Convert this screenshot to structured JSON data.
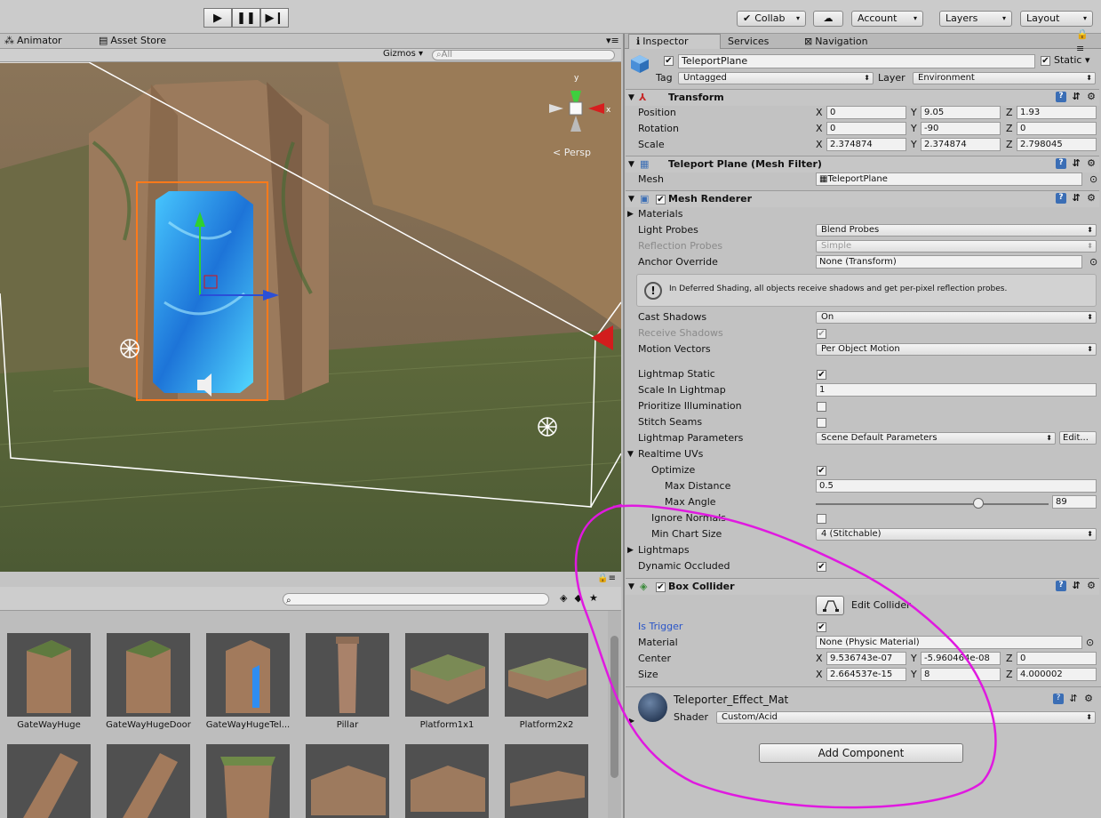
{
  "toolbar": {
    "collab": "Collab",
    "account": "Account",
    "layers": "Layers",
    "layout": "Layout"
  },
  "scene_tabs": {
    "animator": "Animator",
    "asset_store": "Asset Store"
  },
  "scene": {
    "gizmos": "Gizmos",
    "search_placeholder": "All",
    "persp": "Persp",
    "axis_y": "y",
    "axis_x": "x"
  },
  "assets": [
    {
      "name": "GateWayHuge"
    },
    {
      "name": "GateWayHugeDoor"
    },
    {
      "name": "GateWayHugeTel..."
    },
    {
      "name": "Pillar"
    },
    {
      "name": "Platform1x1"
    },
    {
      "name": "Platform2x2"
    }
  ],
  "inspector": {
    "tabs": [
      "Inspector",
      "Services",
      "Navigation"
    ],
    "object_name": "TeleportPlane",
    "static_label": "Static",
    "tag_label": "Tag",
    "tag_value": "Untagged",
    "layer_label": "Layer",
    "layer_value": "Environment",
    "transform": {
      "title": "Transform",
      "position": {
        "label": "Position",
        "x": "0",
        "y": "9.05",
        "z": "1.93"
      },
      "rotation": {
        "label": "Rotation",
        "x": "0",
        "y": "-90",
        "z": "0"
      },
      "scale": {
        "label": "Scale",
        "x": "2.374874",
        "y": "2.374874",
        "z": "2.798045"
      }
    },
    "mesh_filter": {
      "title": "Teleport Plane (Mesh Filter)",
      "mesh_label": "Mesh",
      "mesh_value": "TeleportPlane"
    },
    "mesh_renderer": {
      "title": "Mesh Renderer",
      "materials": "Materials",
      "light_probes_label": "Light Probes",
      "light_probes": "Blend Probes",
      "reflection_probes_label": "Reflection Probes",
      "reflection_probes": "Simple",
      "anchor_override_label": "Anchor Override",
      "anchor_override": "None (Transform)",
      "info": "In Deferred Shading, all objects receive shadows and get per-pixel reflection probes.",
      "cast_shadows_label": "Cast Shadows",
      "cast_shadows": "On",
      "receive_shadows_label": "Receive Shadows",
      "motion_vectors_label": "Motion Vectors",
      "motion_vectors": "Per Object Motion",
      "lightmap_static_label": "Lightmap Static",
      "scale_in_lightmap_label": "Scale In Lightmap",
      "scale_in_lightmap": "1",
      "prioritize_label": "Prioritize Illumination",
      "stitch_label": "Stitch Seams",
      "lightmap_params_label": "Lightmap Parameters",
      "lightmap_params": "Scene Default Parameters",
      "edit_label": "Edit...",
      "realtime_uvs": "Realtime UVs",
      "optimize_label": "Optimize",
      "max_distance_label": "Max Distance",
      "max_distance": "0.5",
      "max_angle_label": "Max Angle",
      "max_angle": "89",
      "max_angle_fraction": 0.7,
      "ignore_normals_label": "Ignore Normals",
      "min_chart_label": "Min Chart Size",
      "min_chart": "4 (Stitchable)",
      "lightmaps": "Lightmaps",
      "dynamic_occluded_label": "Dynamic Occluded"
    },
    "box_collider": {
      "title": "Box Collider",
      "edit_collider": "Edit Collider",
      "is_trigger_label": "Is Trigger",
      "material_label": "Material",
      "material": "None (Physic Material)",
      "center": {
        "label": "Center",
        "x": "9.536743e-07",
        "y": "-5.960464e-08",
        "z": "0"
      },
      "size": {
        "label": "Size",
        "x": "2.664537e-15",
        "y": "8",
        "z": "4.000002"
      }
    },
    "material": {
      "name": "Teleporter_Effect_Mat",
      "shader_label": "Shader",
      "shader": "Custom/Acid"
    },
    "add_component": "Add Component"
  },
  "colors": {
    "accent": "#3b6eb5",
    "annotation": "#e019e0",
    "selection": "#ff7a1a"
  }
}
